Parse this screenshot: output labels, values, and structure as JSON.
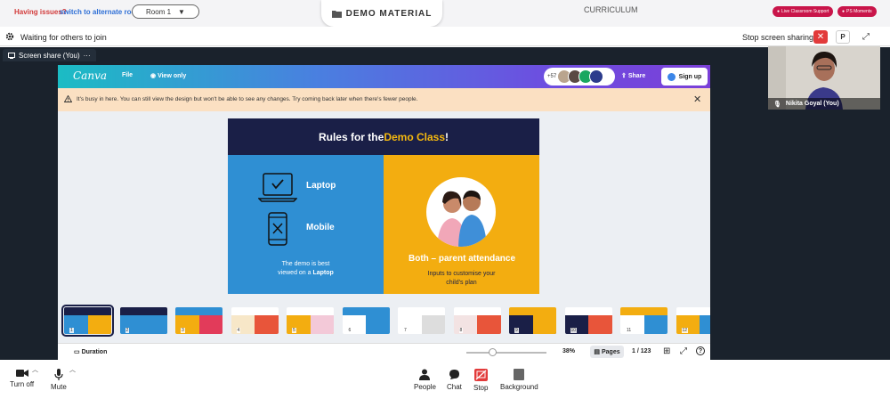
{
  "topbar": {
    "issues_text": "Having issues?",
    "alternate_room_link": "switch to alternate room",
    "room_select_value": "Room 1",
    "demo_material_label": "DEMO MATERIAL",
    "curriculum_label": "CURRICULUM",
    "live_support_label": "Live Classroom Support",
    "ps_moments_label": "PS Moments"
  },
  "status": {
    "waiting_text": "Waiting for others to join",
    "stop_sharing_label": "Stop screen sharing",
    "close_label": "✕",
    "p_label": "P"
  },
  "share_tab": {
    "label": "Screen share (You)",
    "more": "···"
  },
  "canva": {
    "logo": "Canva",
    "file_menu": "File",
    "view_only": "View only",
    "avatar_count": "+57",
    "share_label": "Share",
    "signup_label": "Sign up",
    "busy_message": "It's busy in here. You can still view the design but won't be able to see any changes. Try coming back later when there's fewer people.",
    "banner_close": "✕",
    "slide": {
      "title_prefix": "Rules for the ",
      "title_highlight": "Demo Class",
      "title_suffix": "!",
      "laptop": "Laptop",
      "mobile": "Mobile",
      "best_viewed_line1": "The demo is best",
      "best_viewed_line2_prefix": "viewed on a ",
      "best_viewed_line2_bold": "Laptop",
      "attendance": "Both – parent attendance",
      "customise_line1": "Inputs to customise your",
      "customise_line2": "child's plan"
    },
    "thumbnails": [
      {
        "num": "1",
        "colors": [
          "#1a1f47",
          "#2f8fd3",
          "#f3ad10"
        ]
      },
      {
        "num": "2",
        "colors": [
          "#1a1f47",
          "#2f8fd3",
          "#2f8fd3"
        ]
      },
      {
        "num": "3",
        "colors": [
          "#2f8fd3",
          "#f3ad10",
          "#e23b5a"
        ]
      },
      {
        "num": "4",
        "colors": [
          "#ffffff",
          "#f7e7c8",
          "#e8553a"
        ]
      },
      {
        "num": "5",
        "colors": [
          "#ffffff",
          "#f3ad10",
          "#f3c9d8"
        ]
      },
      {
        "num": "6",
        "colors": [
          "#2f8fd3",
          "#ffffff",
          "#2f8fd3"
        ]
      },
      {
        "num": "7",
        "colors": [
          "#ffffff",
          "#ffffff",
          "#dddddd"
        ]
      },
      {
        "num": "8",
        "colors": [
          "#ffffff",
          "#f3e3e3",
          "#e8553a"
        ]
      },
      {
        "num": "9",
        "colors": [
          "#f3ad10",
          "#1a1f47",
          "#f3ad10"
        ]
      },
      {
        "num": "10",
        "colors": [
          "#ffffff",
          "#1a1f47",
          "#e8553a"
        ]
      },
      {
        "num": "11",
        "colors": [
          "#f3ad10",
          "#ffffff",
          "#2f8fd3"
        ]
      },
      {
        "num": "12",
        "colors": [
          "#ffffff",
          "#f3ad10",
          "#2f8fd3"
        ]
      },
      {
        "num": "13",
        "colors": [
          "#ffffff",
          "#dddddd",
          "#999999"
        ]
      }
    ],
    "duration_label": "Duration",
    "zoom_level": "38%",
    "zoom_fraction": 0.33,
    "pages_label": "Pages",
    "page_count": "1 / 123"
  },
  "video": {
    "participant_name": "Nikita Goyal (You)"
  },
  "controls": {
    "turn_off": "Turn off",
    "mute": "Mute",
    "people": "People",
    "chat": "Chat",
    "stop": "Stop",
    "background": "Background"
  },
  "colors": {
    "accent_red": "#e23b3b",
    "brand_pink": "#c9154a",
    "slide_navy": "#1a1f47",
    "slide_blue": "#2f8fd3",
    "slide_yellow": "#f3ad10"
  }
}
